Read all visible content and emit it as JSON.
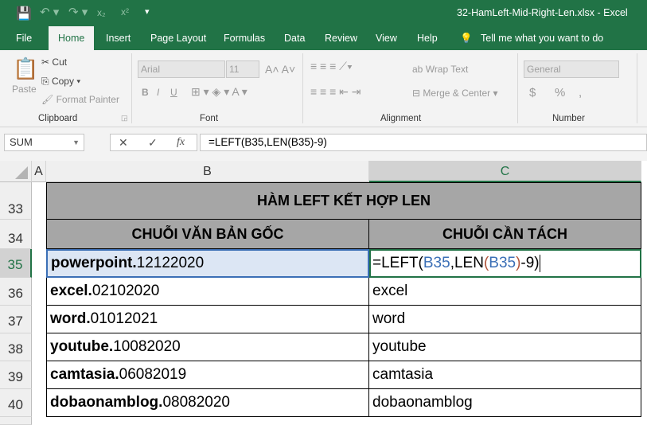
{
  "title_bar": {
    "filename": "32-HamLeft-Mid-Right-Len.xlsx",
    "app": "Excel",
    "separator": "-"
  },
  "tabs": [
    "File",
    "Home",
    "Insert",
    "Page Layout",
    "Formulas",
    "Data",
    "Review",
    "View",
    "Help"
  ],
  "active_tab": "Home",
  "tell_me": "Tell me what you want to do",
  "ribbon": {
    "clipboard": {
      "paste": "Paste",
      "cut": "Cut",
      "copy": "Copy",
      "format_painter": "Format Painter",
      "label": "Clipboard"
    },
    "font": {
      "name": "Arial",
      "size": "11",
      "label": "Font",
      "bold": "B",
      "italic": "I",
      "underline": "U"
    },
    "alignment": {
      "wrap": "Wrap Text",
      "merge": "Merge & Center",
      "label": "Alignment"
    },
    "number": {
      "format": "General",
      "currency": "$",
      "percent": "%",
      "comma": ",",
      "label": "Number"
    }
  },
  "formula_bar": {
    "name_box": "SUM",
    "formula": "=LEFT(B35,LEN(B35)-9)"
  },
  "columns": [
    "A",
    "B",
    "C"
  ],
  "sheet": {
    "title_row": {
      "row": "33",
      "text": "HÀM LEFT KẾT HỢP LEN"
    },
    "header_row": {
      "row": "34",
      "b": "CHUỖI VĂN BẢN GỐC",
      "c": "CHUỖI CẦN TÁCH"
    },
    "editing": {
      "row": "35",
      "bold": "powerpoint.",
      "rest": "12122020",
      "f1": "=LEFT(",
      "ref1": "B35",
      "f2": ",LEN",
      "p1": "(",
      "ref2": "B35",
      "p2": ")",
      "f3": "-9)"
    },
    "rows": [
      {
        "row": "36",
        "bold": "excel.",
        "rest": "02102020",
        "c": "excel"
      },
      {
        "row": "37",
        "bold": "word.",
        "rest": "01012021",
        "c": "word"
      },
      {
        "row": "38",
        "bold": "youtube.",
        "rest": "10082020",
        "c": "youtube"
      },
      {
        "row": "39",
        "bold": "camtasia.",
        "rest": "06082019",
        "c": "camtasia"
      },
      {
        "row": "40",
        "bold": "dobaonamblog.",
        "rest": "08082020",
        "c": "dobaonamblog"
      }
    ]
  },
  "colors": {
    "excel_green": "#217346",
    "ref_blue": "#3b6fb6",
    "ref_red": "#b0533a",
    "header_gray": "#a6a6a6",
    "selection": "#dce6f4"
  }
}
